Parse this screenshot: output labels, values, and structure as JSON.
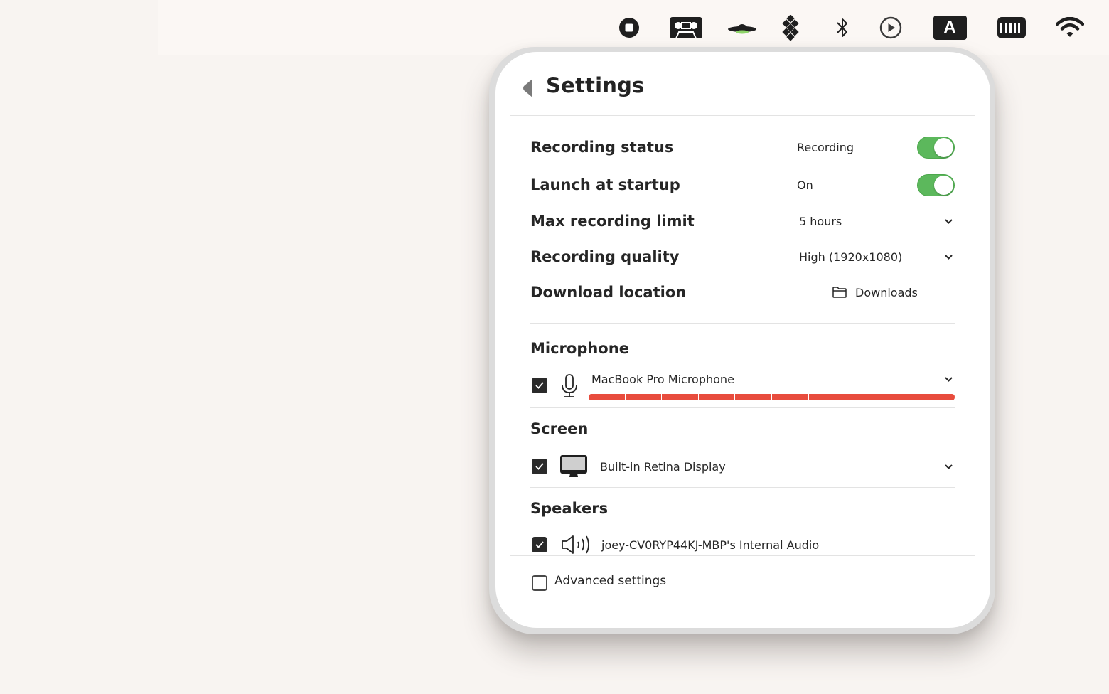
{
  "menubar": {
    "icons": [
      {
        "name": "stop-recording-icon"
      },
      {
        "name": "cassette-icon"
      },
      {
        "name": "ufo-icon"
      },
      {
        "name": "dots-grid-icon"
      },
      {
        "name": "bluetooth-icon"
      },
      {
        "name": "play-circle-icon"
      },
      {
        "name": "input-source-icon",
        "label": "A"
      },
      {
        "name": "battery-icon"
      },
      {
        "name": "wifi-icon"
      }
    ]
  },
  "panel": {
    "title": "Settings",
    "settings": [
      {
        "label": "Recording status",
        "value": "Recording",
        "control": "toggle",
        "on": true
      },
      {
        "label": "Launch at startup",
        "value": "On",
        "control": "toggle",
        "on": true
      },
      {
        "label": "Max recording limit",
        "value": "5 hours",
        "control": "select"
      },
      {
        "label": "Recording quality",
        "value": "High (1920x1080)",
        "control": "select"
      },
      {
        "label": "Download location",
        "value": "Downloads",
        "control": "folder"
      }
    ],
    "sections": {
      "microphone": {
        "title": "Microphone",
        "enabled": true,
        "device": "MacBook Pro Microphone",
        "level_segments_total": 10,
        "level_segments_active": 10,
        "level_color": "#e84c3d"
      },
      "screen": {
        "title": "Screen",
        "enabled": true,
        "device": "Built-in Retina Display"
      },
      "speakers": {
        "title": "Speakers",
        "enabled": true,
        "device": "joey-CV0RYP44KJ-MBP's Internal Audio"
      }
    },
    "advanced": {
      "label": "Advanced settings",
      "checked": false
    }
  },
  "colors": {
    "toggle_on": "#5cb85c",
    "background": "#f8f4f1",
    "panel": "#ffffff",
    "text": "#262626"
  }
}
